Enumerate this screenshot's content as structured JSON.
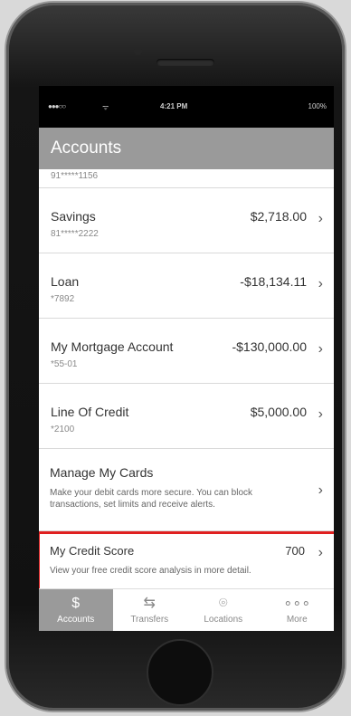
{
  "status": {
    "signal": "●●●○○",
    "wifi": "ᯤ",
    "time": "4:21 PM",
    "battery": "100%"
  },
  "header": {
    "title": "Accounts"
  },
  "accounts": [
    {
      "name": "",
      "number": "91*****1156",
      "amount": ""
    },
    {
      "name": "Savings",
      "number": "81*****2222",
      "amount": "$2,718.00"
    },
    {
      "name": "Loan",
      "number": "*7892",
      "amount": "-$18,134.11"
    },
    {
      "name": "My Mortgage Account",
      "number": "*55-01",
      "amount": "-$130,000.00"
    },
    {
      "name": "Line Of Credit",
      "number": "*2100",
      "amount": "$5,000.00"
    }
  ],
  "manage_cards": {
    "title": "Manage My Cards",
    "description": "Make your debit cards more secure. You can block transactions, set limits and receive alerts."
  },
  "credit_score": {
    "title": "My Credit Score",
    "value": "700",
    "description": "View your free credit score analysis in more detail.",
    "highlight_color": "#e02020"
  },
  "tabs": [
    {
      "label": "Accounts",
      "icon": "dollar-icon",
      "glyph": "$",
      "active": true
    },
    {
      "label": "Transfers",
      "icon": "transfer-arrows-icon",
      "glyph": "⇆"
    },
    {
      "label": "Locations",
      "icon": "map-pin-icon",
      "glyph": "⌾"
    },
    {
      "label": "More",
      "icon": "more-dots-icon",
      "glyph": "∘∘∘"
    }
  ],
  "colors": {
    "header_bg": "#9a9a9a",
    "active_tab_bg": "#9a9a9a"
  }
}
